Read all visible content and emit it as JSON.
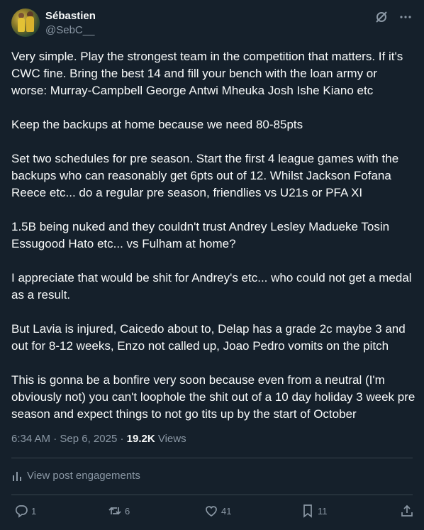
{
  "author": {
    "name": "Sébastien",
    "handle": "@SebC__"
  },
  "icons": {
    "grok": "grok-icon",
    "more": "more-icon",
    "engagements": "bar-chart-icon",
    "reply": "reply-icon",
    "repost": "repost-icon",
    "like": "heart-icon",
    "bookmark": "bookmark-icon",
    "share": "share-icon"
  },
  "post": {
    "paragraphs": [
      "Very simple. Play the strongest team in the competition that matters. If it's CWC fine. Bring the best 14 and fill your bench with the loan army or worse: Murray-Campbell George Antwi Mheuka Josh Ishe Kiano etc",
      "Keep the backups at home because we need 80-85pts",
      "Set two schedules for pre season. Start the first 4 league games with the backups who can reasonably get 6pts out of 12. Whilst Jackson Fofana Reece etc... do a regular pre season, friendlies vs U21s or PFA XI",
      "1.5B being nuked and they couldn't trust Andrey Lesley Madueke Tosin Essugood Hato etc... vs Fulham at home?",
      "I appreciate that would be shit for Andrey's etc... who could not get a medal as a result.",
      "But Lavia is injured, Caicedo about to, Delap has a grade 2c maybe 3 and out for 8-12 weeks, Enzo not called up, Joao Pedro vomits on the pitch",
      "This is gonna be a bonfire very soon because even from a neutral (I'm obviously not) you can't loophole the shit out of a 10 day holiday 3 week pre season and expect things to not go tits up by the start of October"
    ],
    "time": "6:34 AM",
    "separator": "·",
    "date": "Sep 6, 2025",
    "views_count": "19.2K",
    "views_label": "Views"
  },
  "engagements_link": "View post engagements",
  "actions": {
    "replies": "1",
    "reposts": "6",
    "likes": "41",
    "bookmarks": "11"
  },
  "colors": {
    "background": "#15202b",
    "text": "#f7f9f9",
    "muted": "#8b98a5",
    "divider": "#38444d"
  }
}
